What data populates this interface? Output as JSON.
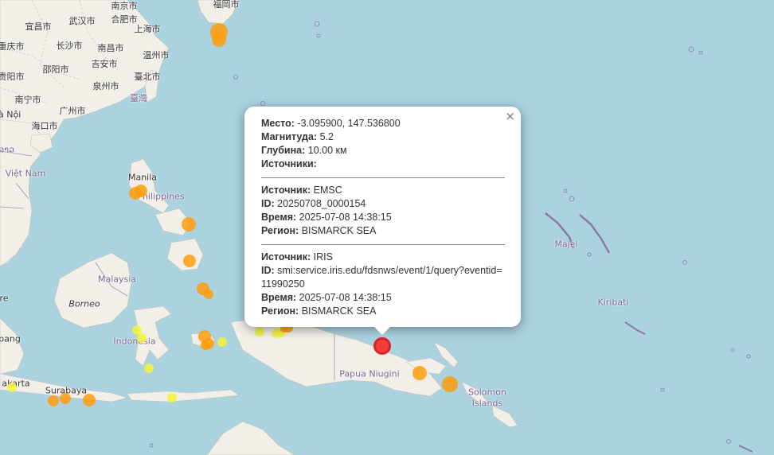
{
  "map": {
    "labels": {
      "nanjing": "南京市",
      "wuhan": "武汉市",
      "hefei": "合肥市",
      "yichang": "宜昌市",
      "shanghai": "上海市",
      "chongqing": "重庆市",
      "changsha": "长沙市",
      "nanchang": "南昌市",
      "wenzhou": "温州市",
      "guiyang": "贵阳市",
      "shaoyang": "邵阳市",
      "jian": "吉安市",
      "quanzhou": "泉州市",
      "taibei": "臺北市",
      "taiwan": "臺灣",
      "nanning": "南宁市",
      "guangzhou": "广州市",
      "hanoi": "Hà Nội",
      "haikou": "海口市",
      "lao": "ລາວ",
      "vietnam": "Việt Nam",
      "fukuoka": "福岡市",
      "manila": "Manila",
      "philippines": "Philippines",
      "malaysia": "Malaysia",
      "borneo": "Borneo",
      "indonesia": "Indonesia",
      "surabaya": "Surabaya",
      "jakarta": "akarta",
      "pang": "pang",
      "re": "re",
      "papua": "Papua Niugini",
      "solomon1": "Solomon",
      "solomon2": "Islands",
      "majel": "Majel",
      "kiribati": "Kiribati"
    },
    "colors": {
      "sea": "#aad3df",
      "land": "#f2efe9",
      "border": "#a08fb0",
      "mag_high": "#ff2b2b",
      "mag_mid": "#ff9e0d",
      "mag_low": "#f5f53a"
    }
  },
  "popup": {
    "close_label": "×",
    "place_label": "Место:",
    "place_value": "-3.095900, 147.536800",
    "magnitude_label": "Магнитуда:",
    "magnitude_value": "5.2",
    "depth_label": "Глубина:",
    "depth_value": "10.00 км",
    "sources_label": "Источники:",
    "sources": [
      {
        "source_label": "Источник:",
        "source_value": "EMSC",
        "id_label": "ID:",
        "id_value": "20250708_0000154",
        "time_label": "Время:",
        "time_value": "2025-07-08 14:38:15",
        "region_label": "Регион:",
        "region_value": "BISMARCK SEA"
      },
      {
        "source_label": "Источник:",
        "source_value": "IRIS",
        "id_label": "ID:",
        "id_value": "smi:service.iris.edu/fdsnws/event/1/query?eventid=11990250",
        "time_label": "Время:",
        "time_value": "2025-07-08 14:38:15",
        "region_label": "Регион:",
        "region_value": "BISMARCK SEA"
      }
    ]
  },
  "earthquakes": [
    {
      "level": "mid"
    },
    {
      "level": "mid"
    },
    {
      "level": "mid"
    },
    {
      "level": "mid"
    },
    {
      "level": "mid"
    },
    {
      "level": "mid"
    },
    {
      "level": "mid"
    },
    {
      "level": "mid"
    },
    {
      "level": "mid"
    },
    {
      "level": "mid"
    },
    {
      "level": "mid"
    },
    {
      "level": "mid"
    },
    {
      "level": "mid"
    },
    {
      "level": "mid"
    },
    {
      "level": "mid"
    },
    {
      "level": "low"
    },
    {
      "level": "low"
    },
    {
      "level": "low"
    },
    {
      "level": "low"
    },
    {
      "level": "low"
    },
    {
      "level": "low"
    },
    {
      "level": "low"
    },
    {
      "level": "low"
    },
    {
      "level": "mid"
    },
    {
      "level": "mid"
    },
    {
      "level": "mid"
    },
    {
      "level": "low"
    },
    {
      "level": "high"
    }
  ]
}
